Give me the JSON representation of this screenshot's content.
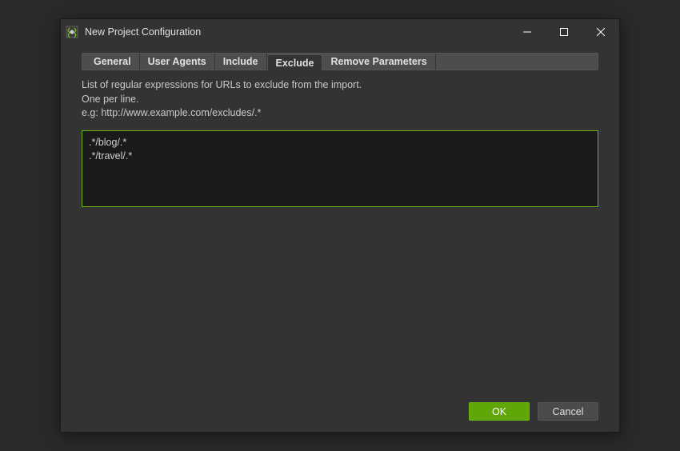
{
  "titlebar": {
    "title": "New Project Configuration"
  },
  "tabs": {
    "items": [
      {
        "label": "General"
      },
      {
        "label": "User Agents"
      },
      {
        "label": "Include"
      },
      {
        "label": "Exclude"
      },
      {
        "label": "Remove Parameters"
      }
    ],
    "active_index": 3
  },
  "description": {
    "line1": "List of regular expressions for URLs to exclude from the import.",
    "line2": "One per line.",
    "line3": "e.g: http://www.example.com/excludes/.*"
  },
  "exclude_textarea": {
    "value": ".*/blog/.*\n.*/travel/.*"
  },
  "buttons": {
    "ok": "OK",
    "cancel": "Cancel"
  }
}
